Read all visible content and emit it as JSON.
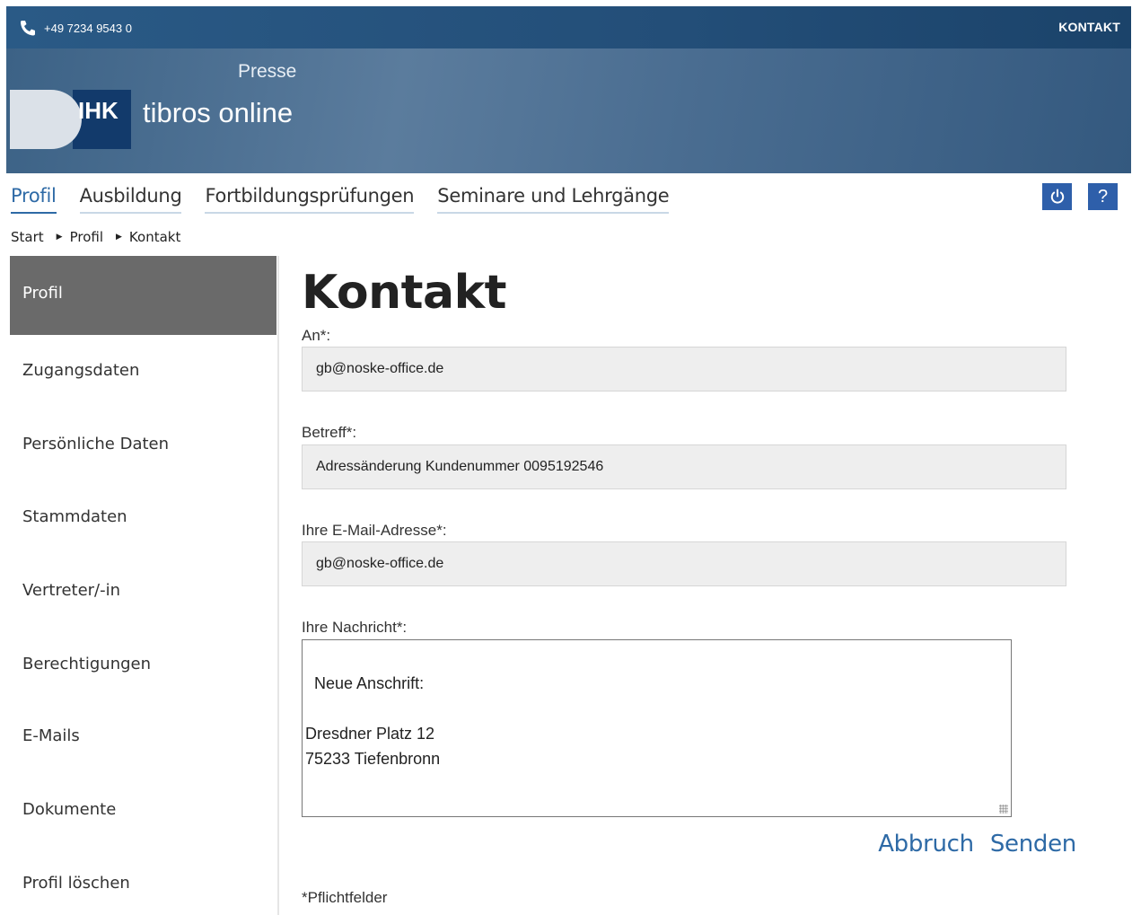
{
  "topbar": {
    "phone": "+49 7234 9543 0",
    "kontakt": "KONTAKT"
  },
  "header": {
    "presse": "Presse",
    "logo_text": "IHK",
    "brand": "tibros online"
  },
  "mainnav": {
    "items": [
      {
        "label": "Profil",
        "active": true
      },
      {
        "label": "Ausbildung"
      },
      {
        "label": "Fortbildungsprüfungen"
      },
      {
        "label": "Seminare und Lehrgänge"
      }
    ],
    "power_icon": "power-icon",
    "help_label": "?"
  },
  "breadcrumb": [
    "Start",
    "Profil",
    "Kontakt"
  ],
  "sidebar": {
    "items": [
      {
        "label": "Profil",
        "active": true
      },
      {
        "label": "Zugangsdaten"
      },
      {
        "label": "Persönliche Daten"
      },
      {
        "label": "Stammdaten"
      },
      {
        "label": "Vertreter/-in"
      },
      {
        "label": "Berechtigungen"
      },
      {
        "label": "E-Mails"
      },
      {
        "label": "Dokumente"
      },
      {
        "label": "Profil löschen"
      }
    ]
  },
  "form": {
    "title": "Kontakt",
    "to_label": "An*:",
    "to_value": "gb@noske-office.de",
    "subject_label": "Betreff*:",
    "subject_value": "Adressänderung Kundenummer 0095192546",
    "email_label": "Ihre E-Mail-Adresse*:",
    "email_value": "gb@noske-office.de",
    "message_label": "Ihre Nachricht*:",
    "message_value": "Neue Anschrift:\n\nDresdner Platz 12\n75233 Tiefenbronn",
    "cancel_label": "Abbruch",
    "send_label": "Senden",
    "footnote": "*Pflichtfelder"
  },
  "colors": {
    "accent": "#2e6aa6",
    "topbar": "#234e78",
    "sidebar_active": "#6a6a6a",
    "button": "#2e5faa"
  }
}
